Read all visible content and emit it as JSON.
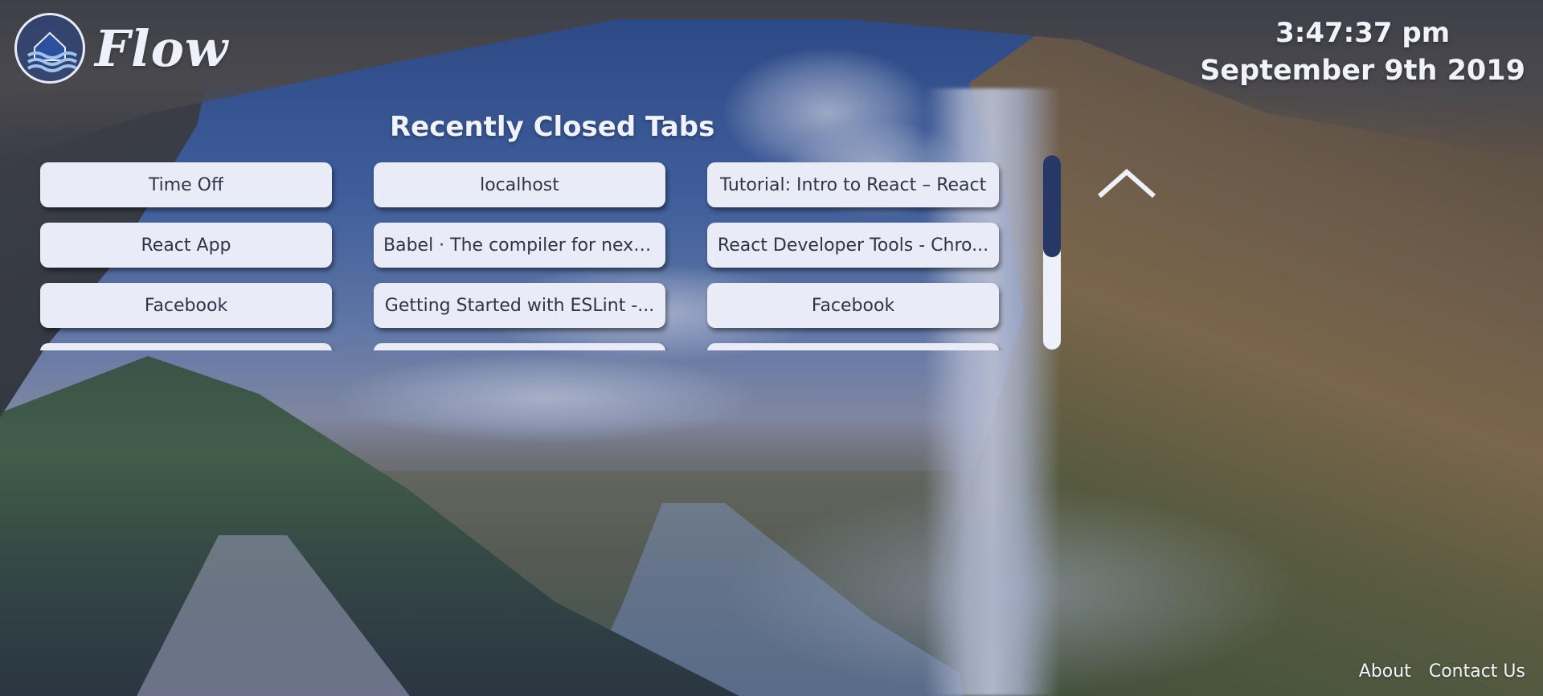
{
  "app": {
    "name": "Flow"
  },
  "clock": {
    "time": "3:47:37 pm",
    "date": "September 9th 2019"
  },
  "recent_tabs": {
    "title": "Recently Closed Tabs",
    "items": [
      "Time Off",
      "localhost",
      "Tutorial: Intro to React – React",
      "React App",
      "Babel · The compiler for next ...",
      "React Developer Tools - Chro...",
      "Facebook",
      "Getting Started with ESLint -...",
      "Facebook",
      "",
      "",
      ""
    ],
    "scroll_position": 0.0,
    "collapse_icon": "chevron-up-icon"
  },
  "footer": {
    "about": "About",
    "contact": "Contact Us"
  },
  "colors": {
    "card_bg": "#e9ecf7",
    "card_text": "#2f3448",
    "scroll_thumb": "#263866",
    "overlay_tint": "#23376e"
  }
}
